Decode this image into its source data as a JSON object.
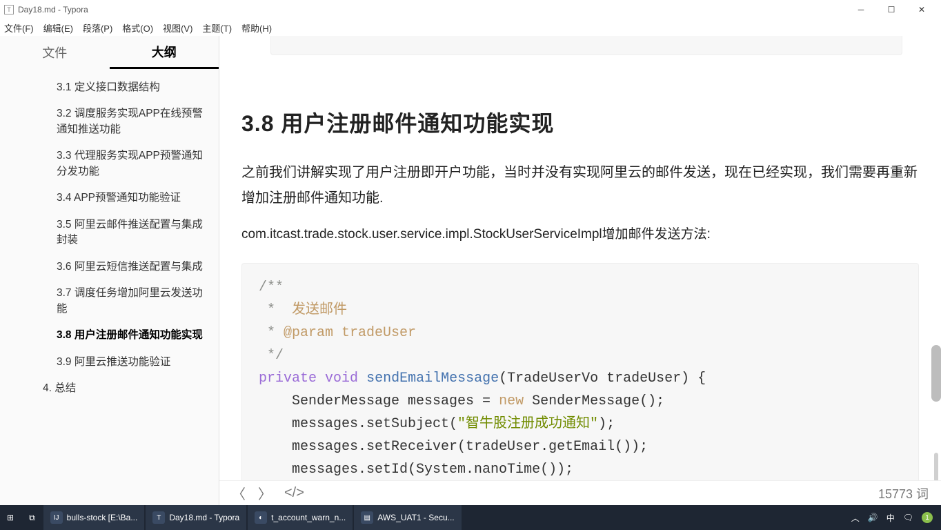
{
  "window": {
    "title": "Day18.md - Typora",
    "icon_letter": "T"
  },
  "menus": {
    "file": "文件(F)",
    "edit": "编辑(E)",
    "paragraph": "段落(P)",
    "format": "格式(O)",
    "view": "视图(V)",
    "theme": "主题(T)",
    "help": "帮助(H)"
  },
  "sidebar": {
    "tab_files": "文件",
    "tab_outline": "大纲",
    "items": [
      {
        "label": "3.1 定义接口数据结构",
        "level": 2,
        "active": false
      },
      {
        "label": "3.2 调度服务实现APP在线预警通知推送功能",
        "level": 2,
        "active": false
      },
      {
        "label": "3.3 代理服务实现APP预警通知分发功能",
        "level": 2,
        "active": false
      },
      {
        "label": "3.4 APP预警通知功能验证",
        "level": 2,
        "active": false
      },
      {
        "label": "3.5 阿里云邮件推送配置与集成封装",
        "level": 2,
        "active": false
      },
      {
        "label": "3.6 阿里云短信推送配置与集成",
        "level": 2,
        "active": false
      },
      {
        "label": "3.7 调度任务增加阿里云发送功能",
        "level": 2,
        "active": false
      },
      {
        "label": "3.8 用户注册邮件通知功能实现",
        "level": 2,
        "active": true
      },
      {
        "label": "3.9 阿里云推送功能验证",
        "level": 2,
        "active": false
      },
      {
        "label": "4. 总结",
        "level": 1,
        "active": false
      }
    ]
  },
  "content": {
    "heading": "3.8  用户注册邮件通知功能实现",
    "para1": "之前我们讲解实现了用户注册即开户功能，当时并没有实现阿里云的邮件发送，现在已经实现，我们需要再重新增加注册邮件通知功能.",
    "api_line": "com.itcast.trade.stock.user.service.impl.StockUserServiceImpl增加邮件发送方法:",
    "code": {
      "c1": "/**",
      "c2": " *  发送邮件",
      "c3": " * @param tradeUser",
      "c4": " */",
      "kw_private": "private",
      "kw_void": "void",
      "fn": "sendEmailMessage",
      "sig_rest": "(TradeUserVo tradeUser) {",
      "l1a": "    SenderMessage messages = ",
      "kw_new": "new",
      "l1b": " SenderMessage();",
      "l2a": "    messages.setSubject(",
      "str1": "\"智牛股注册成功通知\"",
      "l2b": ");",
      "l3": "    messages.setReceiver(tradeUser.getEmail());",
      "l4": "    messages.setId(System.nanoTime());"
    }
  },
  "footer": {
    "word_count": "15773 词"
  },
  "taskbar": {
    "items": [
      {
        "label": "bulls-stock [E:\\Ba..."
      },
      {
        "label": "Day18.md - Typora"
      },
      {
        "label": "t_account_warn_n..."
      },
      {
        "label": "AWS_UAT1 - Secu..."
      }
    ],
    "tray_lang": "中"
  }
}
